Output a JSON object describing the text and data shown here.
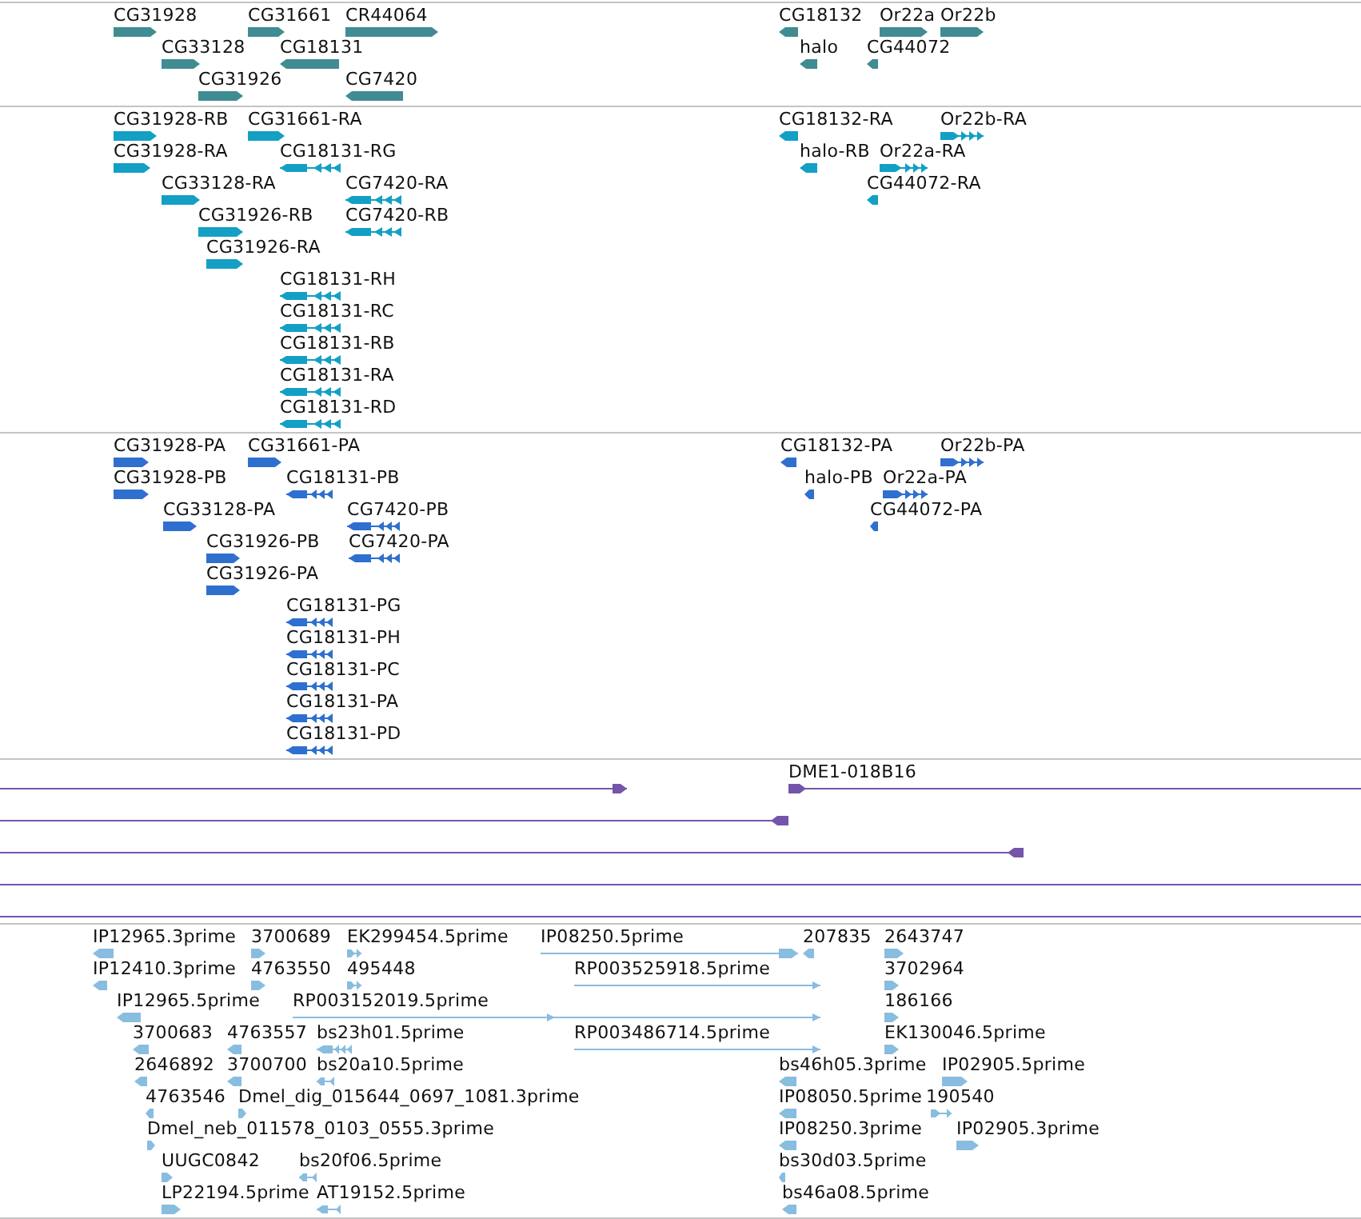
{
  "tracks": [
    {
      "color": "#3f8c92",
      "features": [
        {
          "label": "CG31928",
          "reverse": false
        },
        {
          "label": "CG31661",
          "reverse": false
        },
        {
          "label": "CR44064",
          "reverse": false
        },
        {
          "label": "CG18132",
          "reverse": true
        },
        {
          "label": "Or22a",
          "reverse": false
        },
        {
          "label": "Or22b",
          "reverse": false
        },
        {
          "label": "CG33128",
          "reverse": false
        },
        {
          "label": "CG18131",
          "reverse": true
        },
        {
          "label": "halo",
          "reverse": true
        },
        {
          "label": "CG44072",
          "reverse": true
        },
        {
          "label": "CG31926",
          "reverse": false
        },
        {
          "label": "CG7420",
          "reverse": true
        }
      ]
    },
    {
      "color": "#14a0c4",
      "features": [
        {
          "label": "CG31928-RB",
          "reverse": false
        },
        {
          "label": "CG31661-RA",
          "reverse": false
        },
        {
          "label": "CG18132-RA",
          "reverse": true
        },
        {
          "label": "Or22b-RA",
          "reverse": false
        },
        {
          "label": "CG31928-RA",
          "reverse": false
        },
        {
          "label": "CG18131-RG",
          "reverse": true
        },
        {
          "label": "halo-RB",
          "reverse": true
        },
        {
          "label": "Or22a-RA",
          "reverse": false
        },
        {
          "label": "CG33128-RA",
          "reverse": false
        },
        {
          "label": "CG7420-RA",
          "reverse": true
        },
        {
          "label": "CG44072-RA",
          "reverse": true
        },
        {
          "label": "CG31926-RB",
          "reverse": false
        },
        {
          "label": "CG7420-RB",
          "reverse": true
        },
        {
          "label": "CG31926-RA",
          "reverse": false
        },
        {
          "label": "CG18131-RH",
          "reverse": true
        },
        {
          "label": "CG18131-RC",
          "reverse": true
        },
        {
          "label": "CG18131-RB",
          "reverse": true
        },
        {
          "label": "CG18131-RA",
          "reverse": true
        },
        {
          "label": "CG18131-RD",
          "reverse": true
        }
      ]
    },
    {
      "color": "#2f6fcf",
      "features": [
        {
          "label": "CG31928-PA",
          "reverse": false
        },
        {
          "label": "CG31661-PA",
          "reverse": false
        },
        {
          "label": "CG18132-PA",
          "reverse": true
        },
        {
          "label": "Or22b-PA",
          "reverse": false
        },
        {
          "label": "CG31928-PB",
          "reverse": false
        },
        {
          "label": "CG18131-PB",
          "reverse": true
        },
        {
          "label": "halo-PB",
          "reverse": true
        },
        {
          "label": "Or22a-PA",
          "reverse": false
        },
        {
          "label": "CG33128-PA",
          "reverse": false
        },
        {
          "label": "CG7420-PB",
          "reverse": true
        },
        {
          "label": "CG44072-PA",
          "reverse": true
        },
        {
          "label": "CG31926-PB",
          "reverse": false
        },
        {
          "label": "CG7420-PA",
          "reverse": true
        },
        {
          "label": "CG31926-PA",
          "reverse": false
        },
        {
          "label": "CG18131-PG",
          "reverse": true
        },
        {
          "label": "CG18131-PH",
          "reverse": true
        },
        {
          "label": "CG18131-PC",
          "reverse": true
        },
        {
          "label": "CG18131-PA",
          "reverse": true
        },
        {
          "label": "CG18131-PD",
          "reverse": true
        }
      ]
    },
    {
      "color": "#7455a9",
      "features": [
        {
          "kind": "block",
          "reverse": false
        },
        {
          "kind": "block",
          "label": "DME1-018B16",
          "reverse": false
        },
        {
          "kind": "block",
          "reverse": true
        },
        {
          "kind": "block",
          "reverse": true
        },
        {
          "kind": "plain"
        },
        {
          "kind": "plain"
        }
      ]
    },
    {
      "color": "#88bde0",
      "features": [
        {
          "label": "IP12965.3prime",
          "reverse": true
        },
        {
          "label": "3700689",
          "reverse": false
        },
        {
          "label": "EK299454.5prime",
          "reverse": false
        },
        {
          "label": "IP08250.5prime",
          "reverse": false
        },
        {
          "label": "207835",
          "reverse": true
        },
        {
          "label": "2643747",
          "reverse": false
        },
        {
          "label": "IP12410.3prime",
          "reverse": true
        },
        {
          "label": "4763550",
          "reverse": false
        },
        {
          "label": "495448",
          "reverse": false
        },
        {
          "label": "RP003525918.5prime",
          "reverse": false
        },
        {
          "label": "3702964",
          "reverse": false
        },
        {
          "label": "IP12965.5prime",
          "reverse": true
        },
        {
          "label": "RP003152019.5prime",
          "reverse": false
        },
        {
          "label": "186166",
          "reverse": false
        },
        {
          "label": "3700683",
          "reverse": true
        },
        {
          "label": "4763557",
          "reverse": true
        },
        {
          "label": "bs23h01.5prime",
          "reverse": true
        },
        {
          "label": "RP003486714.5prime",
          "reverse": false
        },
        {
          "label": "EK130046.5prime",
          "reverse": false
        },
        {
          "label": "2646892",
          "reverse": true
        },
        {
          "label": "3700700",
          "reverse": true
        },
        {
          "label": "bs20a10.5prime",
          "reverse": true
        },
        {
          "label": "bs46h05.3prime",
          "reverse": true
        },
        {
          "label": "IP02905.5prime",
          "reverse": false
        },
        {
          "label": "4763546",
          "reverse": true
        },
        {
          "label": "Dmel_dig_015644_0697_1081.3prime",
          "reverse": false
        },
        {
          "label": "IP08050.5prime",
          "reverse": true
        },
        {
          "label": "190540",
          "reverse": false
        },
        {
          "label": "Dmel_neb_011578_0103_0555.3prime",
          "reverse": false
        },
        {
          "label": "IP08250.3prime",
          "reverse": true
        },
        {
          "label": "IP02905.3prime",
          "reverse": false
        },
        {
          "label": "UUGC0842",
          "reverse": false
        },
        {
          "label": "bs20f06.5prime",
          "reverse": true
        },
        {
          "label": "bs30d03.5prime",
          "reverse": true
        },
        {
          "label": "LP22194.5prime",
          "reverse": false
        },
        {
          "label": "AT19152.5prime",
          "reverse": true
        },
        {
          "label": "bs46a08.5prime",
          "reverse": true
        }
      ]
    }
  ]
}
